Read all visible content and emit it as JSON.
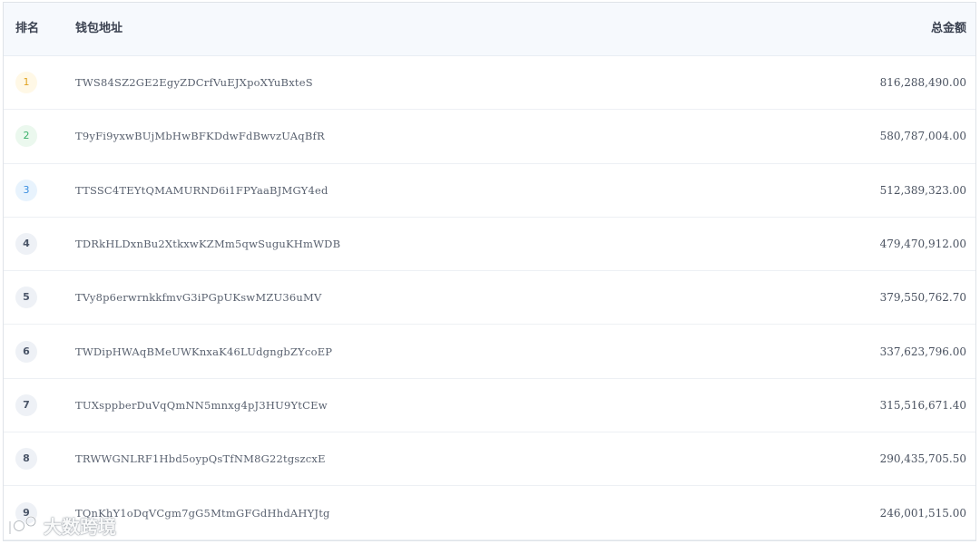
{
  "table": {
    "headers": {
      "rank": "排名",
      "address": "钱包地址",
      "total": "总金额"
    },
    "rows": [
      {
        "rank": "1",
        "address": "TWS84SZ2GE2EgyZDCrfVuEJXpoXYuBxteS",
        "total": "816,288,490.00",
        "style": "gold"
      },
      {
        "rank": "2",
        "address": "T9yFi9yxwBUjMbHwBFKDdwFdBwvzUAqBfR",
        "total": "580,787,004.00",
        "style": "green"
      },
      {
        "rank": "3",
        "address": "TTSSC4TEYtQMAMURND6i1FPYaaBJMGY4ed",
        "total": "512,389,323.00",
        "style": "blue"
      },
      {
        "rank": "4",
        "address": "TDRkHLDxnBu2XtkxwKZMm5qwSuguKHmWDB",
        "total": "479,470,912.00",
        "style": "grey"
      },
      {
        "rank": "5",
        "address": "TVy8p6erwrnkkfmvG3iPGpUKswMZU36uMV",
        "total": "379,550,762.70",
        "style": "grey"
      },
      {
        "rank": "6",
        "address": "TWDipHWAqBMeUWKnxaK46LUdgngbZYcoEP",
        "total": "337,623,796.00",
        "style": "grey"
      },
      {
        "rank": "7",
        "address": "TUXsppberDuVqQmNN5mnxg4pJ3HU9YtCEw",
        "total": "315,516,671.40",
        "style": "grey"
      },
      {
        "rank": "8",
        "address": "TRWWGNLRF1Hbd5oypQsTfNM8G22tgszcxE",
        "total": "290,435,705.50",
        "style": "grey"
      },
      {
        "rank": "9",
        "address": "TQnKhY1oDqVCgm7gG5MtmGFGdHhdAHYJtg",
        "total": "246,001,515.00",
        "style": "grey"
      }
    ]
  },
  "watermark": {
    "text": "大数跨境"
  },
  "colors": {
    "header_bg": "#f6f9fd",
    "gold": "#e0a220",
    "green": "#3ab06a",
    "blue": "#3a8ee0"
  }
}
